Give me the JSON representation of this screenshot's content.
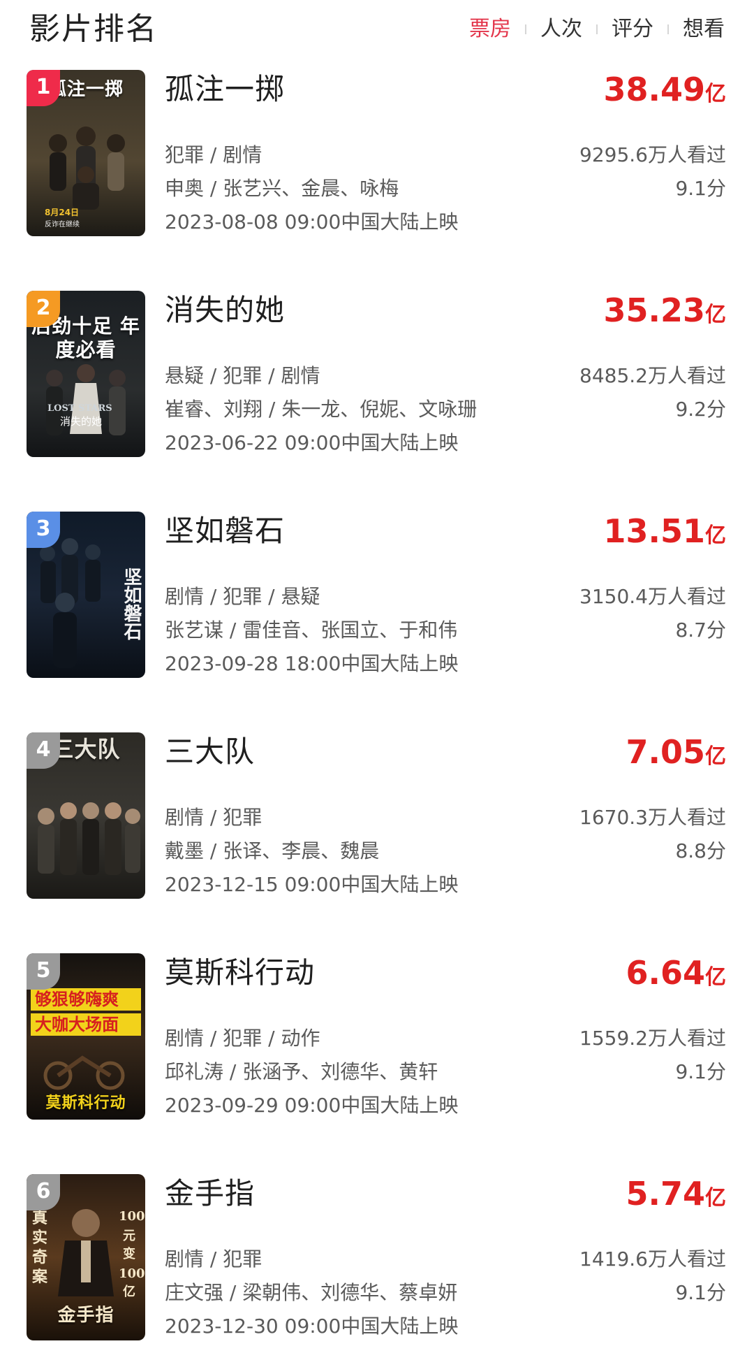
{
  "header": {
    "title": "影片排名",
    "tabs": [
      {
        "label": "票房",
        "active": true
      },
      {
        "label": "人次",
        "active": false
      },
      {
        "label": "评分",
        "active": false
      },
      {
        "label": "想看",
        "active": false
      }
    ]
  },
  "colors": {
    "accent": "#e3344a",
    "box_office": "#e02121",
    "rank1": "#ef2b4a",
    "rank2": "#f59a23",
    "rank3": "#5a8fe6",
    "rank_other": "#9a9a9a"
  },
  "films": [
    {
      "rank": "1",
      "title": "孤注一掷",
      "box_office_value": "38.49",
      "box_office_unit": "亿",
      "genre": "犯罪 / 剧情",
      "people": "申奥 / 张艺兴、金晨、咏梅",
      "release": "2023-08-08 09:00中国大陆上映",
      "viewers": "9295.6万人看过",
      "score": "9.1分",
      "poster_text": "孤注一掷"
    },
    {
      "rank": "2",
      "title": "消失的她",
      "box_office_value": "35.23",
      "box_office_unit": "亿",
      "genre": "悬疑 / 犯罪 / 剧情",
      "people": "崔睿、刘翔 / 朱一龙、倪妮、文咏珊",
      "release": "2023-06-22 09:00中国大陆上映",
      "viewers": "8485.2万人看过",
      "score": "9.2分",
      "poster_text": "后劲十足 年度必看"
    },
    {
      "rank": "3",
      "title": "坚如磐石",
      "box_office_value": "13.51",
      "box_office_unit": "亿",
      "genre": "剧情 / 犯罪 / 悬疑",
      "people": "张艺谋 / 雷佳音、张国立、于和伟",
      "release": "2023-09-28 18:00中国大陆上映",
      "viewers": "3150.4万人看过",
      "score": "8.7分",
      "poster_text": "坚如磐石"
    },
    {
      "rank": "4",
      "title": "三大队",
      "box_office_value": "7.05",
      "box_office_unit": "亿",
      "genre": "剧情 / 犯罪",
      "people": "戴墨 / 张译、李晨、魏晨",
      "release": "2023-12-15 09:00中国大陆上映",
      "viewers": "1670.3万人看过",
      "score": "8.8分",
      "poster_text": "三大队"
    },
    {
      "rank": "5",
      "title": "莫斯科行动",
      "box_office_value": "6.64",
      "box_office_unit": "亿",
      "genre": "剧情 / 犯罪 / 动作",
      "people": "邱礼涛 / 张涵予、刘德华、黄轩",
      "release": "2023-09-29 09:00中国大陆上映",
      "viewers": "1559.2万人看过",
      "score": "9.1分",
      "poster_text": "莫斯科行动"
    },
    {
      "rank": "6",
      "title": "金手指",
      "box_office_value": "5.74",
      "box_office_unit": "亿",
      "genre": "剧情 / 犯罪",
      "people": "庄文强 / 梁朝伟、刘德华、蔡卓妍",
      "release": "2023-12-30 09:00中国大陆上映",
      "viewers": "1419.6万人看过",
      "score": "9.1分",
      "poster_text": "金手指"
    }
  ]
}
